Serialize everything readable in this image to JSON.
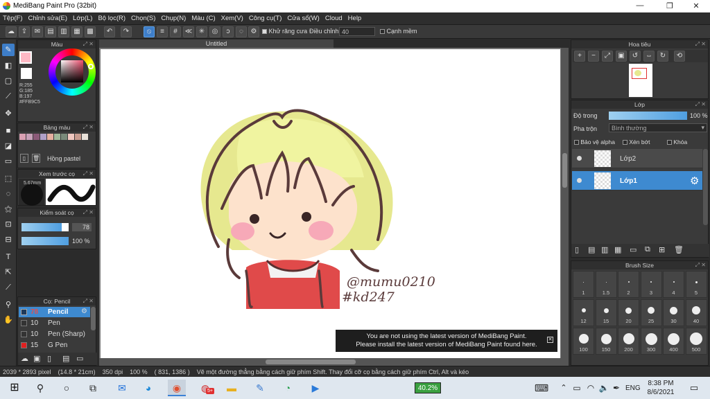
{
  "window": {
    "title": "MediBang Paint Pro (32bit)",
    "min": "—",
    "max": "❐",
    "close": "✕"
  },
  "menu": [
    "Tệp(F)",
    "Chỉnh sửa(E)",
    "Lớp(L)",
    "Bộ lọc(R)",
    "Chọn(S)",
    "Chụp(N)",
    "Màu (C)",
    "Xem(V)",
    "Công cụ(T)",
    "Cửa sổ(W)",
    "Cloud",
    "Help"
  ],
  "toolbar": {
    "antialias_label": "Khử răng cưa",
    "adjust_label": "Điều chỉnh",
    "adjust_value": "40",
    "edge_label": "Cạnh mềm"
  },
  "color_panel": {
    "title": "Màu",
    "r": "R:255",
    "g": "G:185",
    "b": "B:197",
    "hex": "#FFB9C5",
    "primary": "#FFB9C5"
  },
  "palette_panel": {
    "title": "Bảng màu",
    "swatches": [
      "#d9a0b3",
      "#c7a0b8",
      "#8b5a78",
      "#b0a0c8",
      "#e6b0a0",
      "#a0b89a",
      "#7a8a7a",
      "#f0c8c0",
      "#c89c90",
      "#e8e0d8"
    ],
    "name": "Hồng pastel"
  },
  "brush_preview": {
    "title": "Xem trước cọ",
    "size_label": "5.67mm"
  },
  "brush_control": {
    "title": "Kiểm soát cọ",
    "size_value": "78",
    "size_fraction": 0.85,
    "opacity_value": "100 %",
    "opacity_fraction": 1.0
  },
  "brush_list": {
    "title": "Cọ: Pencil",
    "items": [
      {
        "size": "78",
        "name": "Pencil",
        "color": "#1f3a5a"
      },
      {
        "size": "10",
        "name": "Pen",
        "color": "#333333"
      },
      {
        "size": "10",
        "name": "Pen (Sharp)",
        "color": "#333333"
      },
      {
        "size": "15",
        "name": "G Pen",
        "color": "#e02020"
      }
    ]
  },
  "canvas": {
    "tab_title": "Untitled",
    "signature_line1": "@mumu0210",
    "signature_line2": "#kd247"
  },
  "notice": {
    "line1": "You are not using the latest version of MediBang Paint.",
    "line2": "Please install the latest version of MediBang Paint found here."
  },
  "navigator_panel": {
    "title": "Hoa tiêu"
  },
  "layer_panel": {
    "title": "Lớp",
    "opacity_label": "Độ trong",
    "opacity_value": "100 %",
    "opacity_fraction": 1.0,
    "blend_label": "Pha trộn",
    "blend_value": "Bình thường",
    "protect_alpha": "Bảo vệ alpha",
    "clipping": "Xén bớt",
    "lock": "Khóa",
    "layers": [
      {
        "name": "Lớp2",
        "selected": false
      },
      {
        "name": "Lớp1",
        "selected": true
      }
    ]
  },
  "brush_size_panel": {
    "title": "Brush Size",
    "sizes": [
      "1",
      "1.5",
      "2",
      "3",
      "4",
      "5",
      "12",
      "15",
      "20",
      "25",
      "30",
      "40",
      "100",
      "150",
      "200",
      "300",
      "400",
      "500"
    ]
  },
  "status": {
    "dimensions": "2039 * 2893 pixel",
    "physical": "(14.8 * 21cm)",
    "dpi": "350 dpi",
    "zoom": "100 %",
    "coords": "( 831, 1386 )",
    "hint": "Vẽ một đường thẳng bằng cách giữ phím Shift. Thay đổi cỡ cọ bằng cách giữ phím Ctrl, Alt và kéo"
  },
  "taskbar": {
    "badge": "5+",
    "battery_percent": "40.2%",
    "lang": "ENG",
    "time": "8:38 PM",
    "date": "8/6/2021"
  }
}
